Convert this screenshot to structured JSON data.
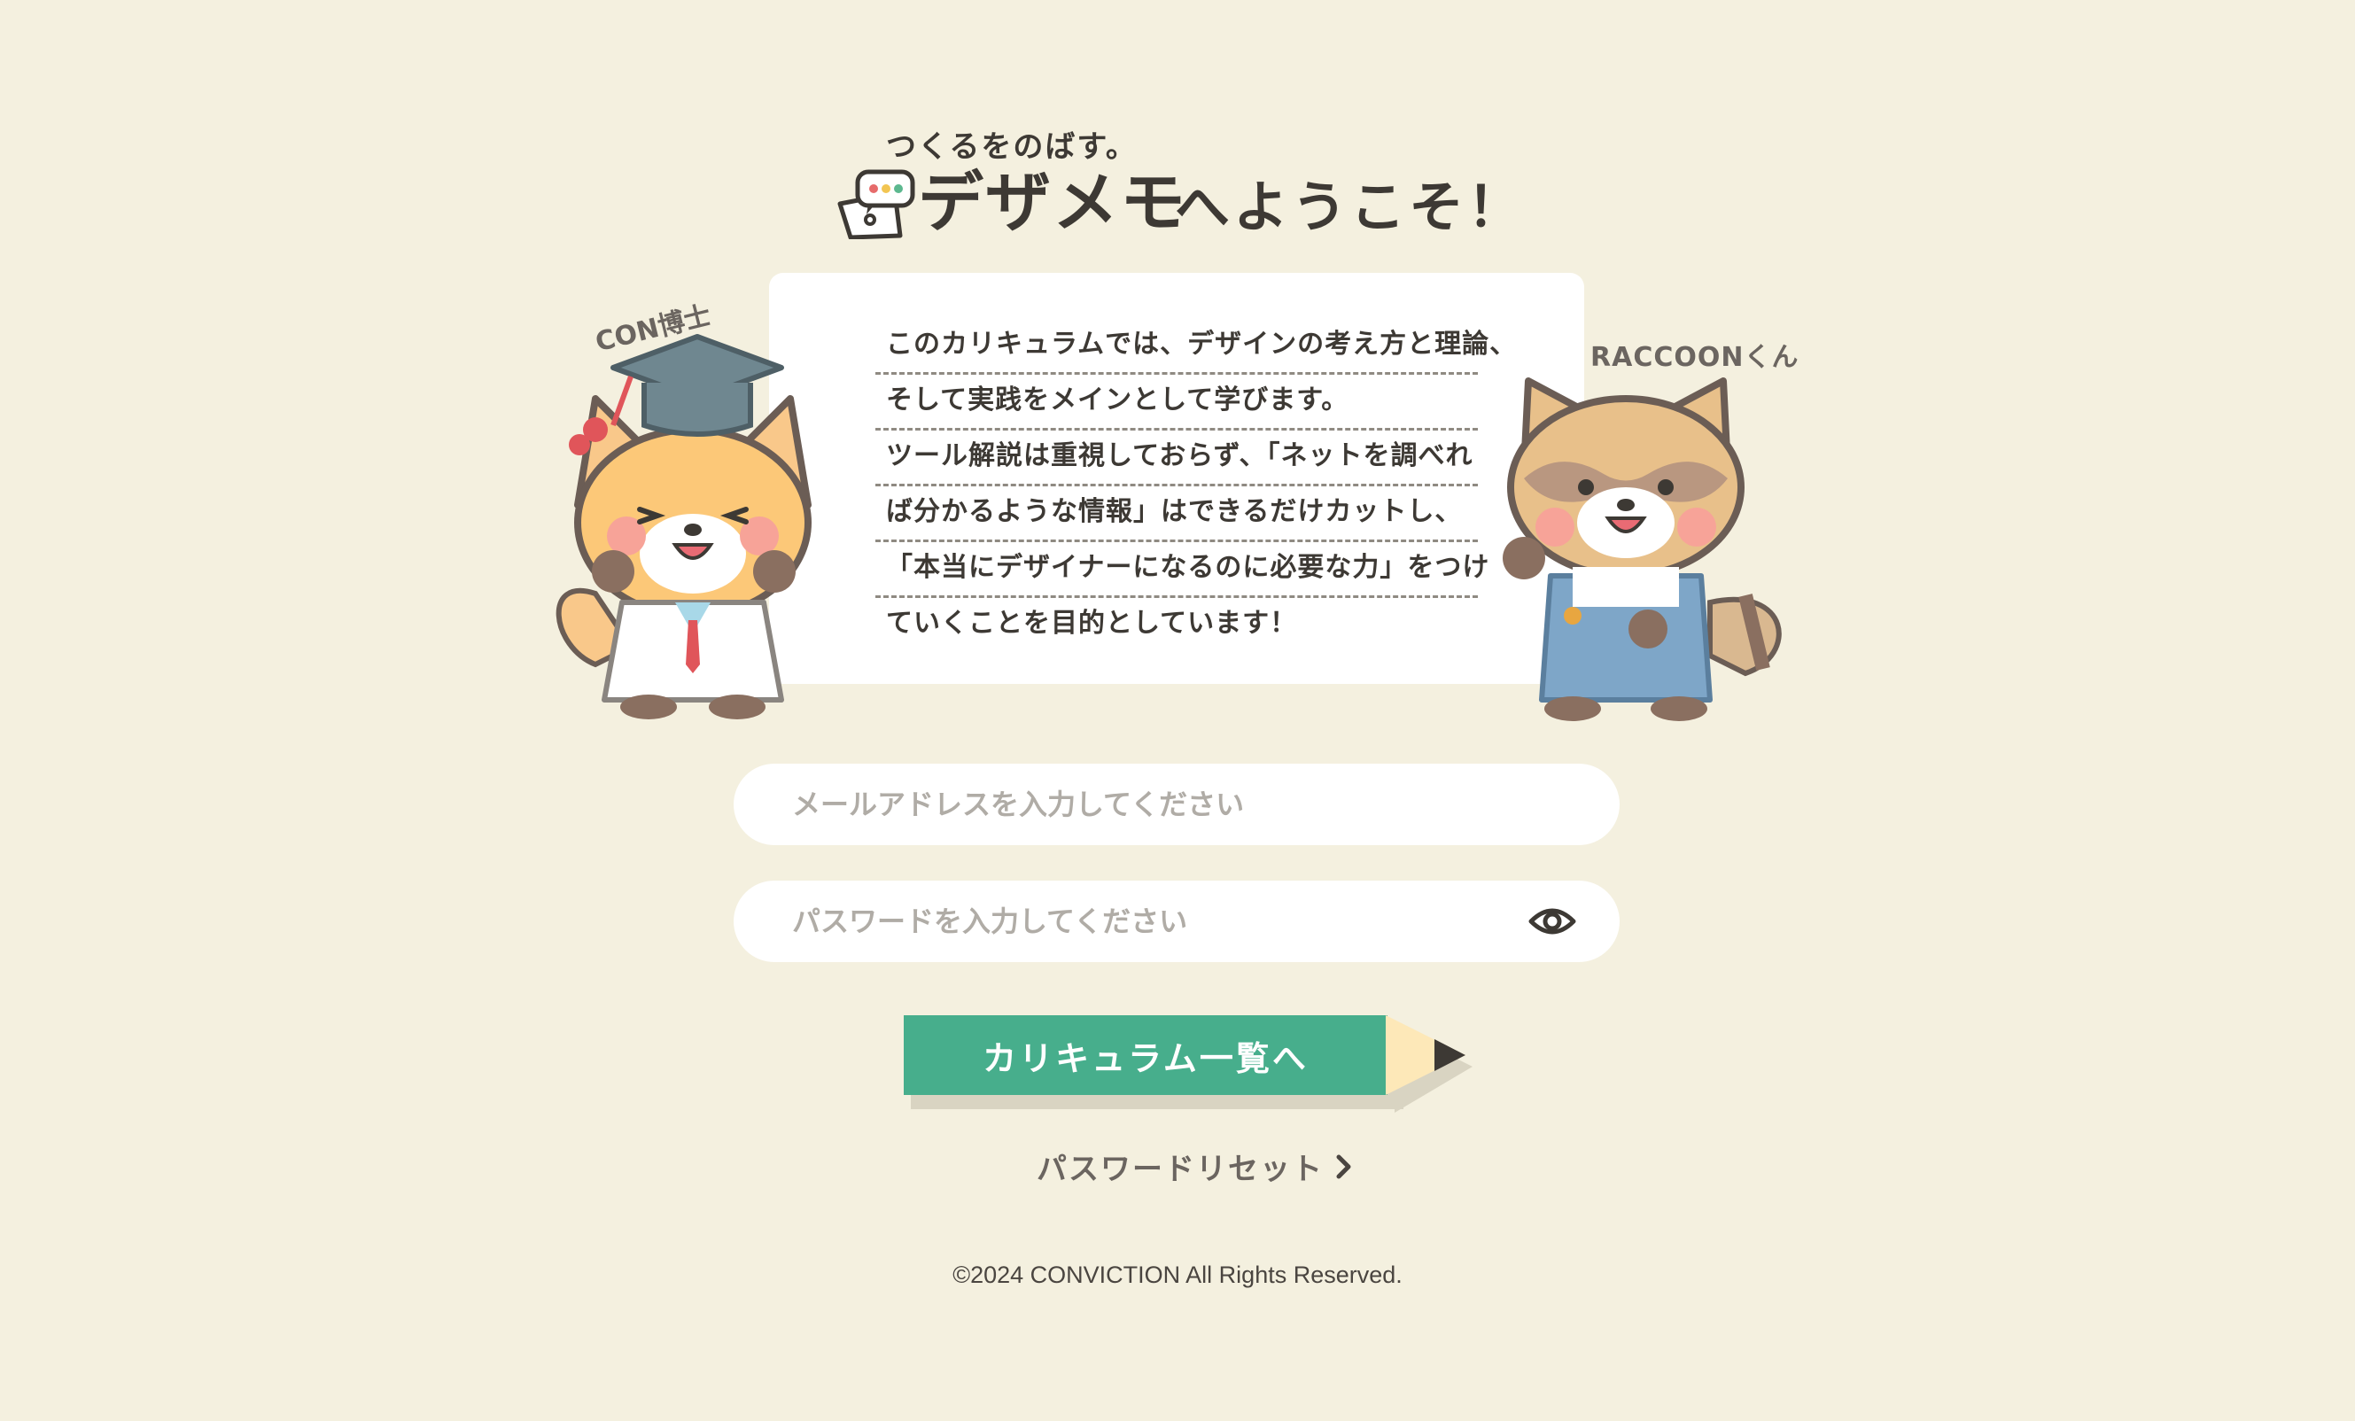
{
  "logo": {
    "tagline": "つくるをのばす。",
    "brand": "デザメモ",
    "welcome": "へようこそ！",
    "icon": "memo-chat-icon"
  },
  "intro": {
    "lines": [
      "このカリキュラムでは、デザインの考え方と理論、",
      "そして実践をメインとして学びます。",
      "ツール解説は重視しておらず、「ネットを調べれ",
      "ば分かるような情報」はできるだけカットし、",
      "「本当にデザイナーになるのに必要な力」をつけ",
      "ていくことを目的としています！"
    ]
  },
  "characters": {
    "left_label": "CON博士",
    "right_label": "RACCOONくん"
  },
  "form": {
    "email_placeholder": "メールアドレスを入力してください",
    "password_placeholder": "パスワードを入力してください",
    "password_toggle_icon": "eye-icon",
    "submit_label": "カリキュラム一覧へ",
    "reset_label": "パスワードリセット",
    "reset_icon": "chevron-right-icon"
  },
  "footer": {
    "copyright": "©2024 CONVICTION All Rights Reserved."
  },
  "colors": {
    "background": "#f4f0df",
    "button": "#47ae8c",
    "text": "#3d3934"
  }
}
